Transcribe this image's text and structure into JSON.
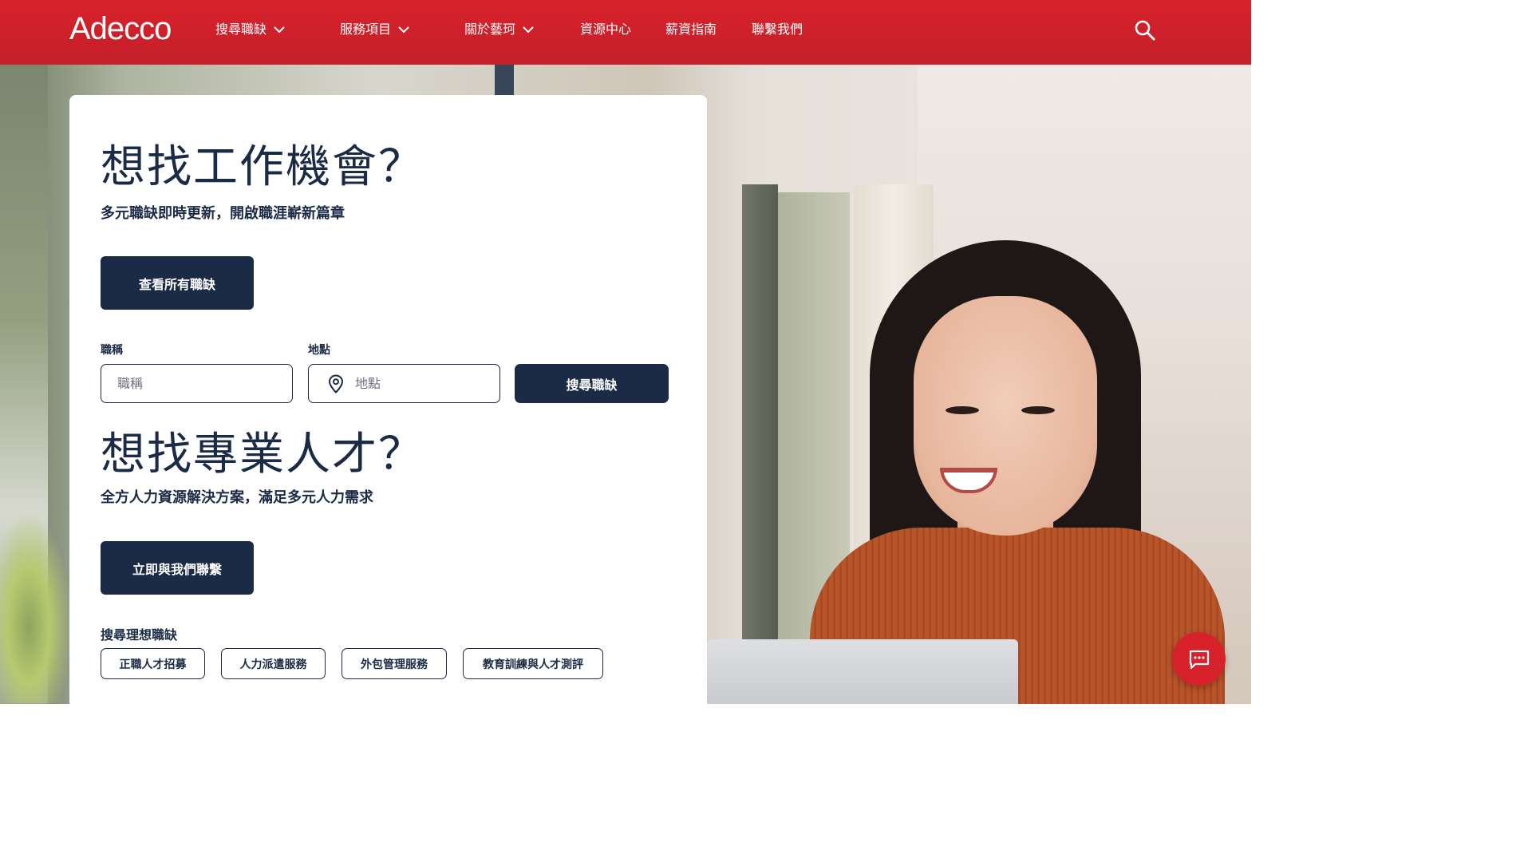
{
  "brand": {
    "name": "Adecco",
    "accent": "#d8222b",
    "navy": "#1b2a45"
  },
  "nav": {
    "items": [
      {
        "label": "搜尋職缺",
        "has_dropdown": true
      },
      {
        "label": "服務項目",
        "has_dropdown": true
      },
      {
        "label": "關於藝珂",
        "has_dropdown": true
      },
      {
        "label": "資源中心",
        "has_dropdown": false
      },
      {
        "label": "薪資指南",
        "has_dropdown": false
      },
      {
        "label": "聯繫我們",
        "has_dropdown": false
      }
    ],
    "search_icon": "search-icon"
  },
  "job_seeker": {
    "title": "想找工作機會？",
    "subtitle": "多元職缺即時更新，開啟職涯嶄新篇章",
    "cta": "查看所有職缺",
    "job_title_label": "職稱",
    "job_title_placeholder": "職稱",
    "location_label": "地點",
    "location_placeholder": "地點",
    "location_icon": "map-pin-icon",
    "search_button": "搜尋職缺"
  },
  "employer": {
    "title": "想找專業人才？",
    "subtitle": "全方人力資源解決方案，滿足多元人力需求",
    "cta": "立即與我們聯繫"
  },
  "quick_links": {
    "title": "搜尋理想職缺",
    "chips": [
      "正職人才招募",
      "人力派遣服務",
      "外包管理服務",
      "教育訓練與人才測評"
    ]
  },
  "chat": {
    "icon": "chat-icon"
  }
}
